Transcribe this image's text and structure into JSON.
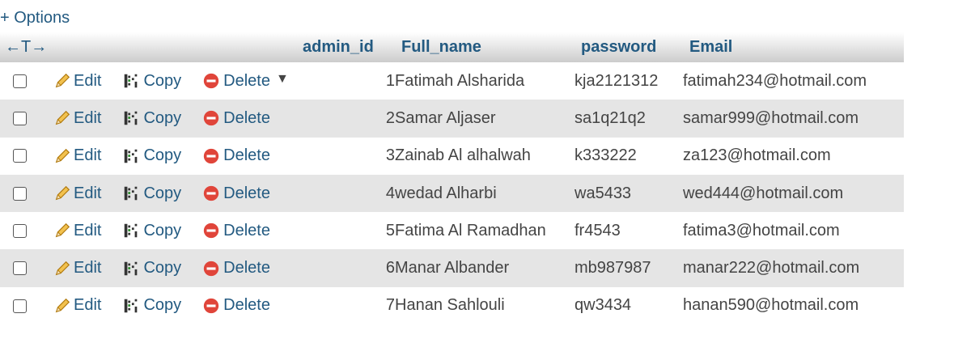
{
  "options_label": "+ Options",
  "header": {
    "nav_arrows": "←T→",
    "sort_indicator": "▼",
    "columns": [
      "admin_id",
      "Full_name",
      "password",
      "Email"
    ]
  },
  "actions": {
    "edit": "Edit",
    "copy": "Copy",
    "delete": "Delete"
  },
  "rows": [
    {
      "admin_id": "1",
      "full_name": "Fatimah Alsharida",
      "password": "kja2121312",
      "email": "fatimah234@hotmail.com"
    },
    {
      "admin_id": "2",
      "full_name": "Samar Aljaser",
      "password": "sa1q21q2",
      "email": "samar999@hotmail.com"
    },
    {
      "admin_id": "3",
      "full_name": "Zainab Al alhalwah",
      "password": "k333222",
      "email": "za123@hotmail.com"
    },
    {
      "admin_id": "4",
      "full_name": "wedad Alharbi",
      "password": "wa5433",
      "email": "wed444@hotmail.com"
    },
    {
      "admin_id": "5",
      "full_name": "Fatima Al Ramadhan",
      "password": "fr4543",
      "email": "fatima3@hotmail.com"
    },
    {
      "admin_id": "6",
      "full_name": "Manar Albander",
      "password": "mb987987",
      "email": "manar222@hotmail.com"
    },
    {
      "admin_id": "7",
      "full_name": "Hanan Sahlouli",
      "password": "qw3434",
      "email": "hanan590@hotmail.com"
    }
  ],
  "colors": {
    "link": "#235a81",
    "row_alt": "#e5e5e5",
    "delete_icon": "#e0453a",
    "edit_icon": "#e8b030"
  }
}
